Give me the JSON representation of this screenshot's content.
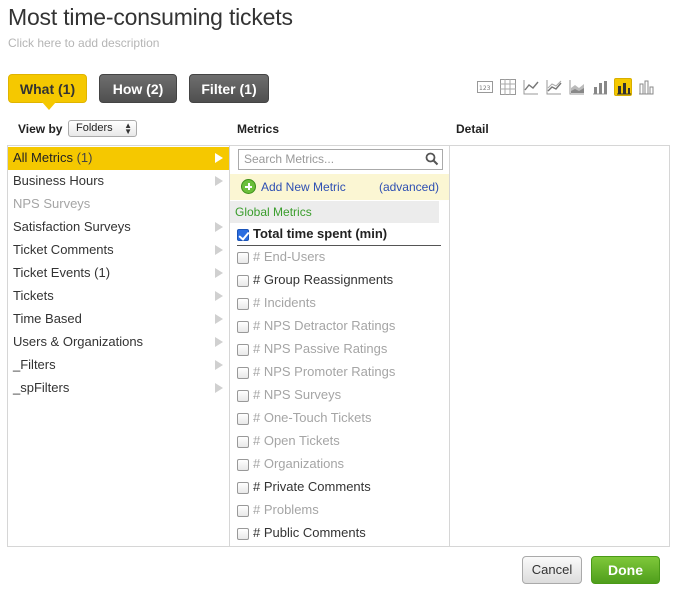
{
  "page": {
    "title": "Most time-consuming tickets",
    "description_placeholder": "Click here to add description"
  },
  "tabs": [
    {
      "label": "What (1)",
      "active": true
    },
    {
      "label": "How (2)",
      "active": false
    },
    {
      "label": "Filter (1)",
      "active": false
    }
  ],
  "chart_types": [
    {
      "icon": "number-icon",
      "active": false
    },
    {
      "icon": "table-icon",
      "active": false
    },
    {
      "icon": "line-chart-icon",
      "active": false
    },
    {
      "icon": "area-line-icon",
      "active": false
    },
    {
      "icon": "stacked-area-icon",
      "active": false
    },
    {
      "icon": "bar-chart-icon",
      "active": false
    },
    {
      "icon": "column-chart-icon",
      "active": true
    },
    {
      "icon": "stacked-column-icon",
      "active": false
    }
  ],
  "columns": {
    "view_by_label": "View by",
    "view_by_value": "Folders",
    "metrics_label": "Metrics",
    "detail_label": "Detail"
  },
  "folders": [
    {
      "label": "All Metrics",
      "count": "(1)",
      "selected": true,
      "disabled": false
    },
    {
      "label": "Business Hours",
      "count": "",
      "selected": false,
      "disabled": false
    },
    {
      "label": "NPS Surveys",
      "count": "",
      "selected": false,
      "disabled": true
    },
    {
      "label": "Satisfaction Surveys",
      "count": "",
      "selected": false,
      "disabled": false
    },
    {
      "label": "Ticket Comments",
      "count": "",
      "selected": false,
      "disabled": false
    },
    {
      "label": "Ticket Events",
      "count": "(1)",
      "selected": false,
      "disabled": false
    },
    {
      "label": "Tickets",
      "count": "",
      "selected": false,
      "disabled": false
    },
    {
      "label": "Time Based",
      "count": "",
      "selected": false,
      "disabled": false
    },
    {
      "label": "Users & Organizations",
      "count": "",
      "selected": false,
      "disabled": false
    },
    {
      "label": "_Filters",
      "count": "",
      "selected": false,
      "disabled": false
    },
    {
      "label": "_spFilters",
      "count": "",
      "selected": false,
      "disabled": false
    }
  ],
  "metrics_panel": {
    "search_placeholder": "Search Metrics...",
    "add_new_label": "Add New Metric",
    "advanced_label": "(advanced)",
    "group_label": "Global Metrics"
  },
  "metrics": [
    {
      "label": "Total time spent (min)",
      "checked": true,
      "dim": false
    },
    {
      "label": "# End-Users",
      "checked": false,
      "dim": true
    },
    {
      "label": "# Group Reassignments",
      "checked": false,
      "dim": false
    },
    {
      "label": "# Incidents",
      "checked": false,
      "dim": true
    },
    {
      "label": "# NPS Detractor Ratings",
      "checked": false,
      "dim": true
    },
    {
      "label": "# NPS Passive Ratings",
      "checked": false,
      "dim": true
    },
    {
      "label": "# NPS Promoter Ratings",
      "checked": false,
      "dim": true
    },
    {
      "label": "# NPS Surveys",
      "checked": false,
      "dim": true
    },
    {
      "label": "# One-Touch Tickets",
      "checked": false,
      "dim": true
    },
    {
      "label": "# Open Tickets",
      "checked": false,
      "dim": true
    },
    {
      "label": "# Organizations",
      "checked": false,
      "dim": true
    },
    {
      "label": "# Private Comments",
      "checked": false,
      "dim": false
    },
    {
      "label": "# Problems",
      "checked": false,
      "dim": true
    },
    {
      "label": "# Public Comments",
      "checked": false,
      "dim": false
    }
  ],
  "buttons": {
    "cancel": "Cancel",
    "done": "Done"
  },
  "colors": {
    "accent": "#f5c800",
    "done_green": "#5aa822",
    "link_blue": "#2e4fb3",
    "group_green": "#3a9d2c"
  }
}
